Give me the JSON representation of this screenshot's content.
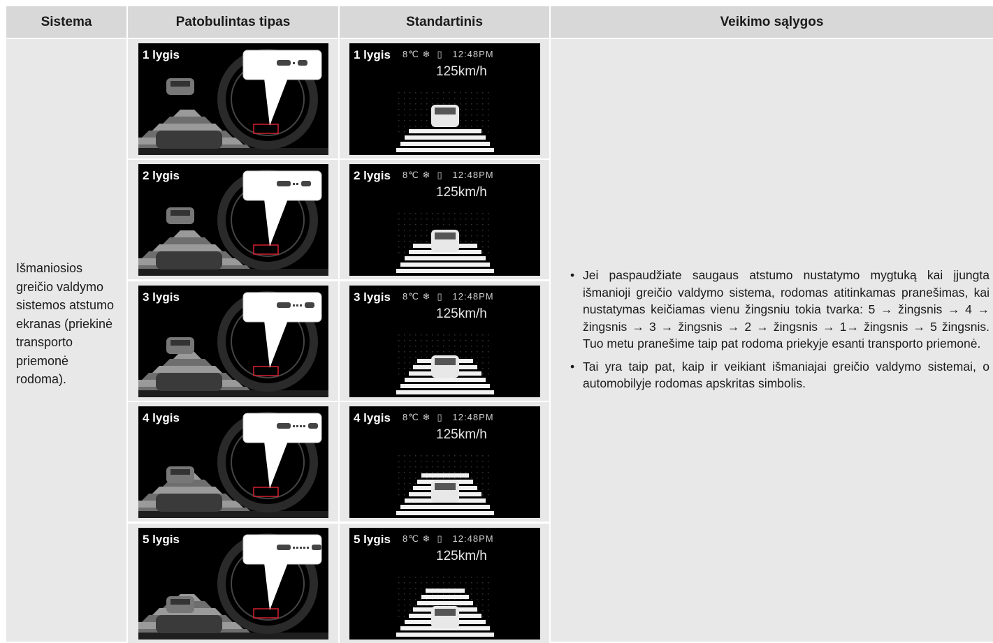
{
  "headers": {
    "sistema": "Sistema",
    "patobulintas": "Patobulintas tipas",
    "standartinis": "Standartinis",
    "veikimo": "Veikimo sąlygos"
  },
  "sistema_text": "Išmaniosios greičio valdymo sistemos atstumo ekranas (priekinė transporto priemonė rodoma).",
  "levels": [
    "1 lygis",
    "2 lygis",
    "3 lygis",
    "4 lygis",
    "5 lygis"
  ],
  "standard_display": {
    "status": "8℃ ❄  ▯   12:48PM",
    "speed": "125km/h"
  },
  "conditions": [
    "Jei paspaudžiate saugaus atstumo nustatymo mygtuką kai įjungta išmanioji greičio valdymo  sistema, rodomas atitinkamas pranešimas, kai nustatymas keičiamas vienu žingsniu tokia tvarka: 5 → žingsnis  → 4 → žingsnis → 3 → žingsnis → 2 → žingsnis → 1→ žingsnis → 5 žingsnis. Tuo metu pranešime taip pat rodoma priekyje esanti transporto priemonė.",
    "Tai yra taip pat, kaip ir veikiant išmaniajai greičio valdymo sistemai, o automobilyje rodomas apskritas simbolis."
  ],
  "colors": {
    "header_bg": "#d8d8d8",
    "cell_bg": "#e8e8e8",
    "highlight_box": "#d42030"
  }
}
